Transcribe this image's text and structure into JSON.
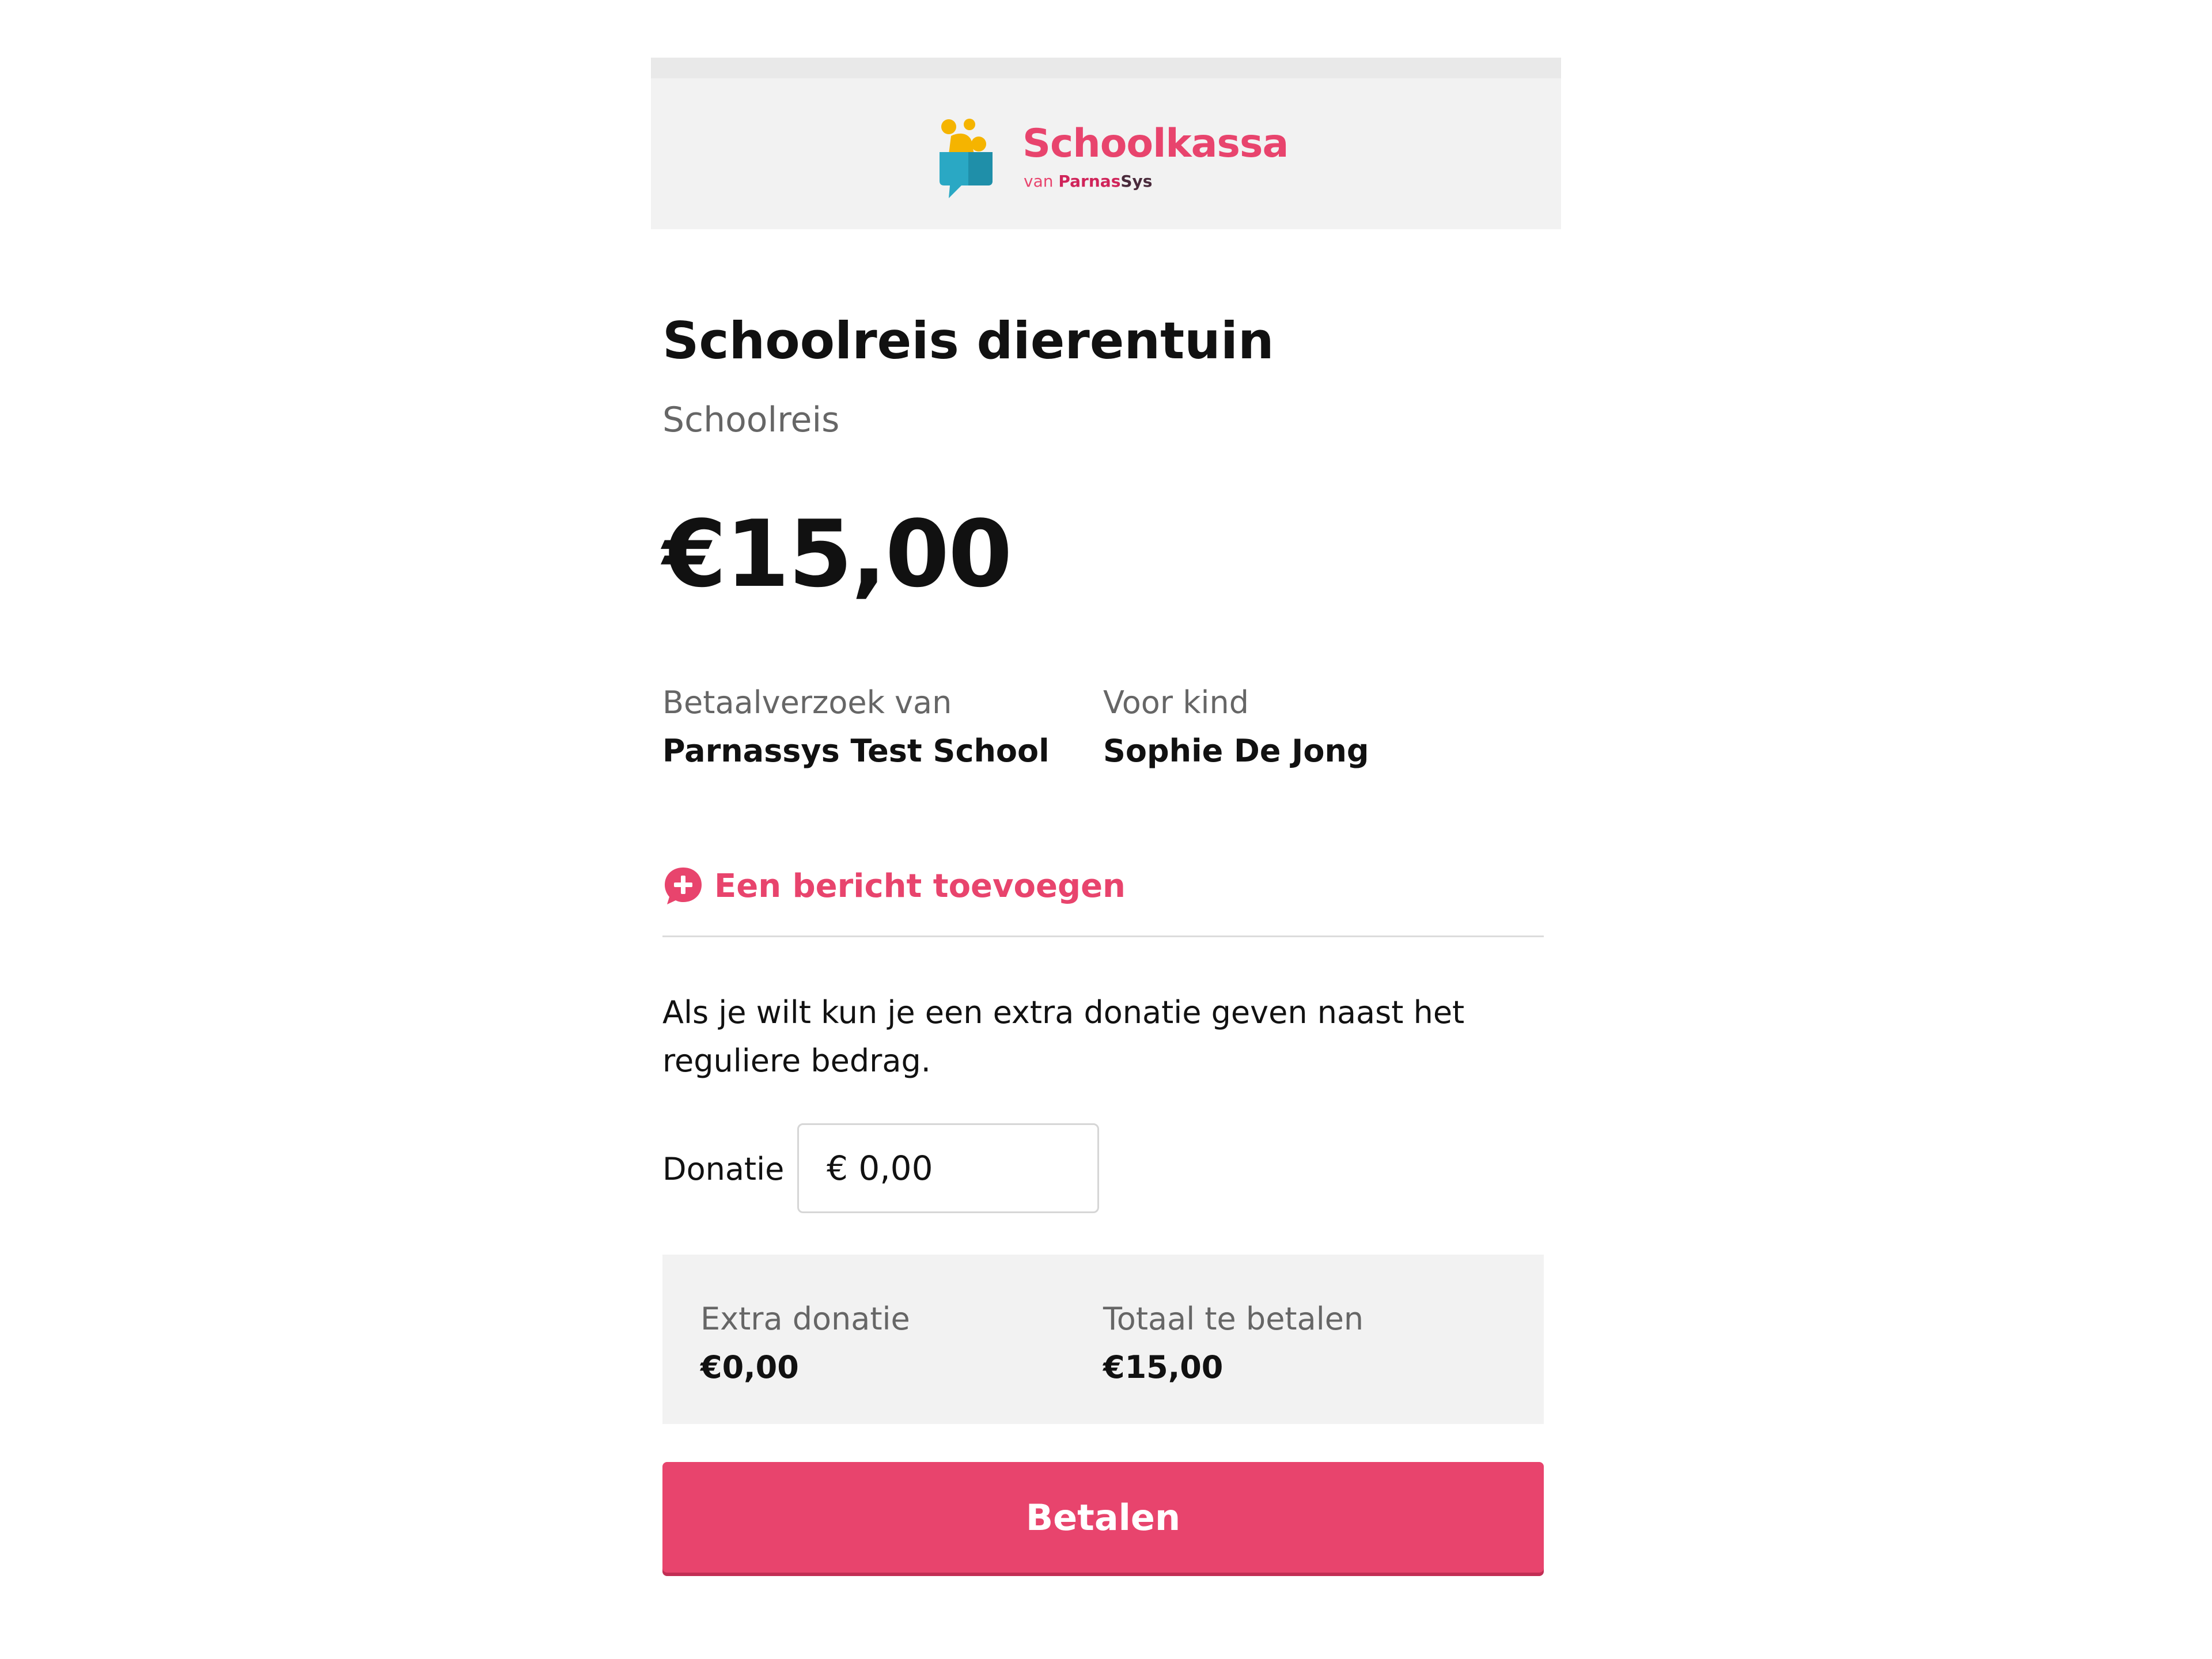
{
  "brand": {
    "name": "Schoolkassa",
    "tagline_prefix": "van",
    "tagline_brand_part1": "Parnas",
    "tagline_brand_part2": "Sys",
    "primary_color": "#e8446d",
    "logo_icon": "schoolkassa-logo-icon"
  },
  "payment": {
    "title": "Schoolreis dierentuin",
    "category": "Schoolreis",
    "amount": "€15,00",
    "request_from_label": "Betaalverzoek van",
    "request_from_value": "Parnassys Test School",
    "child_label": "Voor kind",
    "child_value": "Sophie De Jong"
  },
  "message": {
    "add_label": "Een bericht toevoegen",
    "icon": "add-message-icon"
  },
  "donation": {
    "explanation": "Als je wilt kun je een extra donatie geven naast het reguliere bedrag.",
    "field_label": "Donatie",
    "field_value": "€ 0,00"
  },
  "summary": {
    "extra_label": "Extra donatie",
    "extra_value": "€0,00",
    "total_label": "Totaal te betalen",
    "total_value": "€15,00"
  },
  "actions": {
    "pay_label": "Betalen"
  }
}
